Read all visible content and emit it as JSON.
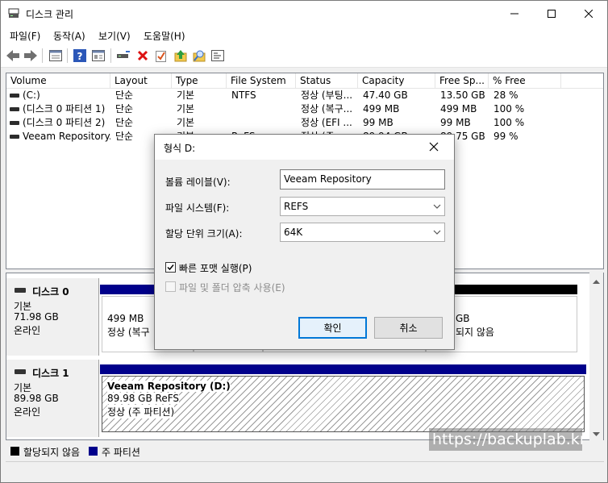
{
  "window": {
    "title": "디스크 관리"
  },
  "menu": [
    "파일(F)",
    "동작(A)",
    "보기(V)",
    "도움말(H)"
  ],
  "toolbar": {
    "icons": [
      "back-icon",
      "forward-icon",
      "list-view-icon",
      "help-icon",
      "properties-icon",
      "connect-icon",
      "delete-icon",
      "check-icon",
      "up-icon",
      "search-icon",
      "console-icon"
    ]
  },
  "volume_list": {
    "columns": [
      "Volume",
      "Layout",
      "Type",
      "File System",
      "Status",
      "Capacity",
      "Free Sp...",
      "% Free"
    ],
    "rows": [
      [
        "(C:)",
        "단순",
        "기본",
        "NTFS",
        "정상 (부팅...",
        "47.40 GB",
        "13.50 GB",
        "28 %"
      ],
      [
        "(디스크 0 파티션 1)",
        "단순",
        "기본",
        "",
        "정상 (복구...",
        "499 MB",
        "499 MB",
        "100 %"
      ],
      [
        "(디스크 0 파티션 2)",
        "단순",
        "기본",
        "",
        "정상 (EFI ...",
        "99 MB",
        "99 MB",
        "100 %"
      ],
      [
        "Veeam Repository...",
        "단순",
        "기본",
        "ReFS",
        "정상 (주...",
        "89.94 GB",
        "89.75 GB",
        "99 %"
      ]
    ]
  },
  "disks": [
    {
      "name": "디스크 0",
      "type": "기본",
      "size": "71.98 GB",
      "state": "온라인",
      "partitions": [
        {
          "line1": "499 MB",
          "line2": "정상 (복구"
        },
        {
          "line1": "GB",
          "line2": "되지 않음"
        }
      ]
    },
    {
      "name": "디스크 1",
      "type": "기본",
      "size": "89.98 GB",
      "state": "온라인",
      "partitions": [
        {
          "title": "Veeam Repository  (D:)",
          "line1": "89.98 GB ReFS",
          "line2": "정상 (주 파티션)"
        }
      ]
    }
  ],
  "legend": [
    {
      "label": "할당되지 않음",
      "color": "#000000"
    },
    {
      "label": "주 파티션",
      "color": "#00008b"
    }
  ],
  "watermark": "https://backuplab.kr",
  "dialog": {
    "title": "형식 D:",
    "volume_label_label": "볼륨 레이블(V):",
    "volume_label_value": "Veeam Repository",
    "file_system_label": "파일 시스템(F):",
    "file_system_value": "REFS",
    "alloc_unit_label": "할당 단위 크기(A):",
    "alloc_unit_value": "64K",
    "quick_format_label": "빠른 포맷 실행(P)",
    "quick_format_checked": true,
    "compression_label": "파일 및 폴더 압축 사용(E)",
    "compression_checked": false,
    "ok_label": "확인",
    "cancel_label": "취소"
  },
  "colors": {
    "primary_partition": "#00008b",
    "unallocated": "#000000",
    "focus": "#0078d7"
  }
}
